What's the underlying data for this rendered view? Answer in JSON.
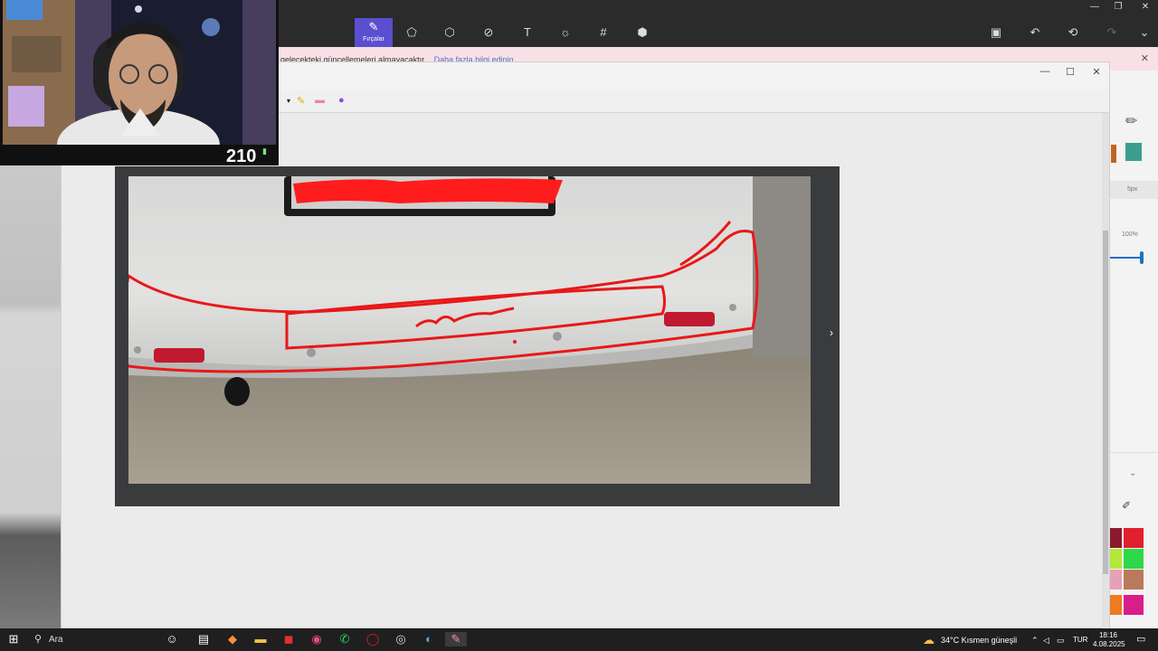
{
  "paint3d": {
    "tools": [
      {
        "name": "brushes",
        "label": "Fırçalar",
        "icon": "brush-icon"
      },
      {
        "name": "2d-shapes",
        "icon": "shapes-2d-icon"
      },
      {
        "name": "3d-shapes",
        "icon": "cube-icon"
      },
      {
        "name": "stickers",
        "icon": "sticker-icon"
      },
      {
        "name": "text",
        "icon": "text-icon"
      },
      {
        "name": "effects",
        "icon": "effects-icon"
      },
      {
        "name": "canvas",
        "icon": "canvas-icon"
      },
      {
        "name": "3d-library",
        "icon": "library-icon"
      }
    ],
    "right_tools": [
      "paste-icon",
      "undo-icon",
      "history-icon",
      "redo-icon",
      "expand-icon"
    ],
    "side_panel": {
      "thickness": "5px",
      "opacity": "100%"
    },
    "palette": [
      "#8b1a2e",
      "#e0202f",
      "#b4e83a",
      "#2fd84a",
      "#e8a0b8",
      "#b87a5a",
      "#f07a20",
      "#d81e8a"
    ]
  },
  "banner": {
    "text": "gelecekteki güncellemeleri almayacaktır.",
    "link": "Daha fazla bilgi edinin"
  },
  "webcam": {
    "viewers": "210"
  },
  "taskbar": {
    "search": "Ara",
    "weather": "34°C  Kısmen güneşli",
    "lang": "TUR",
    "time": "18:16",
    "date": "4.08.2025"
  }
}
